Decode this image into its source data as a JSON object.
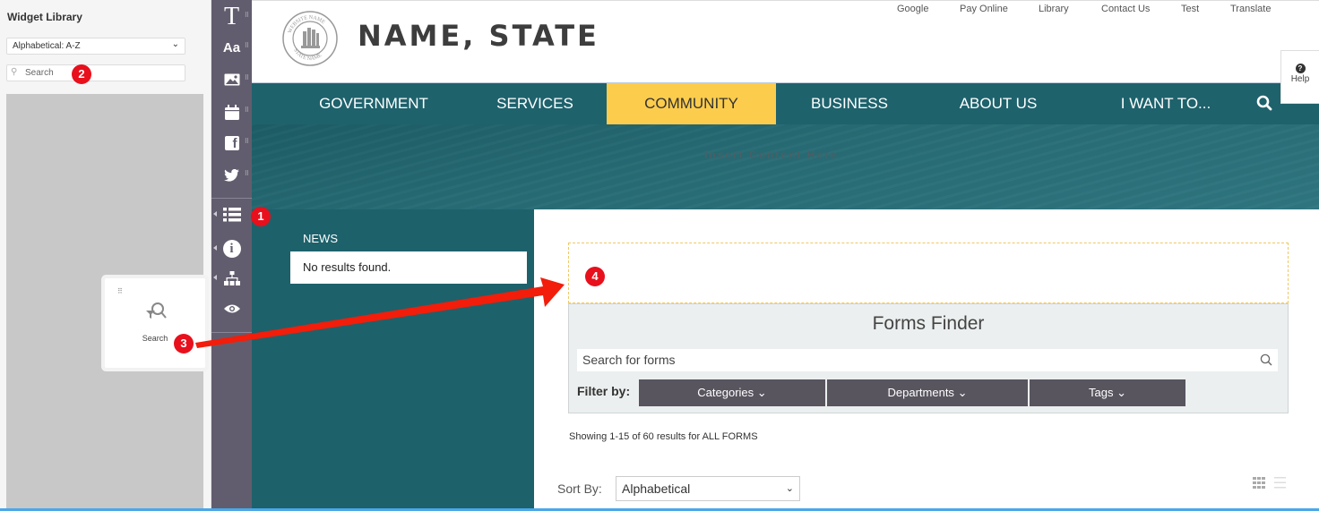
{
  "widget_library": {
    "title": "Widget Library",
    "sort_select": "Alphabetical: A-Z",
    "search_placeholder": "Search",
    "dragged_widget": {
      "label": "Search",
      "icon": "search-filter-icon"
    }
  },
  "tool_rail": {
    "items": [
      {
        "icon": "text-icon",
        "glyph": "T"
      },
      {
        "icon": "font-style-icon",
        "glyph": "Aa"
      },
      {
        "icon": "image-icon"
      },
      {
        "icon": "calendar-icon"
      },
      {
        "icon": "facebook-icon",
        "glyph": "f"
      },
      {
        "icon": "twitter-icon"
      },
      {
        "icon": "list-icon"
      },
      {
        "icon": "info-icon",
        "glyph": "i"
      },
      {
        "icon": "sitemap-icon"
      },
      {
        "icon": "eye-icon"
      }
    ],
    "collapse_glyph": "«"
  },
  "site": {
    "title": "NAME, STATE",
    "seal": {
      "top_text": "WEBSITE NAME",
      "bottom_text": "STATE NAME"
    },
    "utility_links": [
      "Google",
      "Pay Online",
      "Library",
      "Contact Us",
      "Test",
      "Translate"
    ],
    "nav": {
      "items": [
        "GOVERNMENT",
        "SERVICES",
        "COMMUNITY",
        "BUSINESS",
        "ABOUT US",
        "I WANT TO..."
      ],
      "active": "COMMUNITY",
      "active_color": "#fccc4c",
      "bar_color": "#1e626c"
    },
    "hero_text": "Insert Content Here",
    "news": {
      "heading": "NEWS",
      "empty": "No results found."
    },
    "forms_finder": {
      "title": "Forms Finder",
      "search_placeholder": "Search for forms",
      "filter_label": "Filter by:",
      "filters": [
        "Categories",
        "Departments",
        "Tags"
      ],
      "results_text": "Showing 1-15 of 60 results for ALL FORMS",
      "sort_label": "Sort By:",
      "sort_value": "Alphabetical"
    },
    "help_label": "Help"
  },
  "annotations": {
    "badges": [
      "1",
      "2",
      "3",
      "4"
    ],
    "color": "#e8101c"
  }
}
